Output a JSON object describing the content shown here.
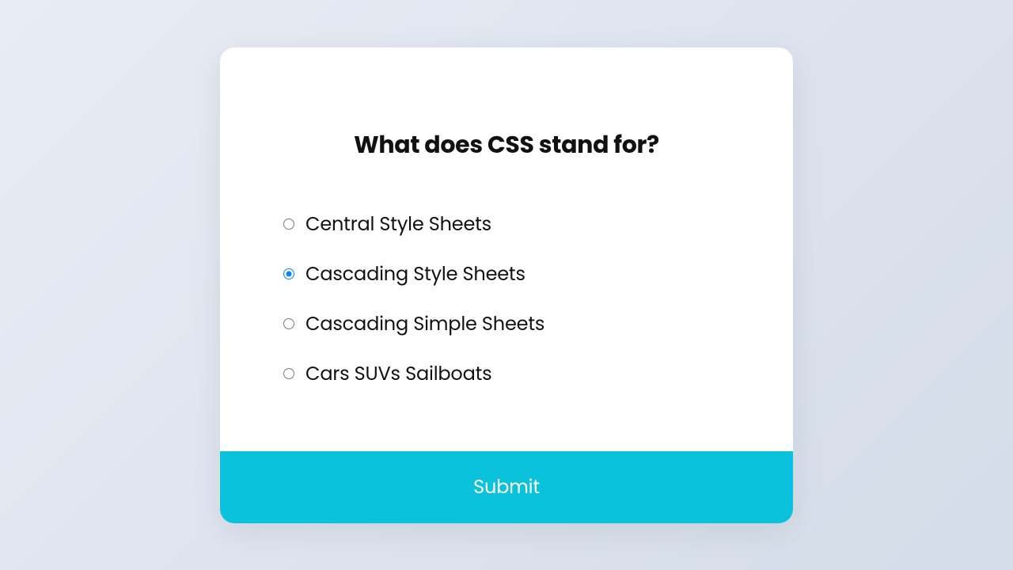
{
  "quiz": {
    "question": "What does CSS stand for?",
    "options": [
      {
        "label": "Central Style Sheets",
        "selected": false
      },
      {
        "label": "Cascading Style Sheets",
        "selected": true
      },
      {
        "label": "Cascading Simple Sheets",
        "selected": false
      },
      {
        "label": "Cars SUVs Sailboats",
        "selected": false
      }
    ],
    "submit_label": "Submit"
  },
  "colors": {
    "accent": "#0bc2dd",
    "radio_active": "#0a84ff"
  }
}
